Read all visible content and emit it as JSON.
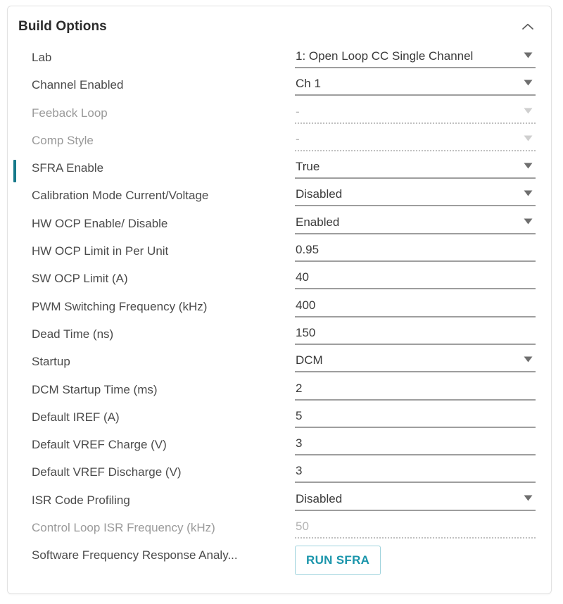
{
  "panel": {
    "title": "Build Options",
    "collapse_icon": "chevron-up-icon",
    "accent_color": "#16798a",
    "border_color": "#e2e2e2",
    "button_accent": "#1a95ab"
  },
  "rows": [
    {
      "label": "Lab",
      "value": "1: Open Loop CC Single Channel",
      "type": "dropdown",
      "disabled": false,
      "selected": false
    },
    {
      "label": "Channel Enabled",
      "value": "Ch 1",
      "type": "dropdown",
      "disabled": false,
      "selected": false
    },
    {
      "label": "Feeback Loop",
      "value": "-",
      "type": "dropdown",
      "disabled": true,
      "selected": false
    },
    {
      "label": "Comp Style",
      "value": "-",
      "type": "dropdown",
      "disabled": true,
      "selected": false
    },
    {
      "label": "SFRA Enable",
      "value": "True",
      "type": "dropdown",
      "disabled": false,
      "selected": true
    },
    {
      "label": "Calibration Mode Current/Voltage",
      "value": "Disabled",
      "type": "dropdown",
      "disabled": false,
      "selected": false
    },
    {
      "label": "HW OCP Enable/ Disable",
      "value": "Enabled",
      "type": "dropdown",
      "disabled": false,
      "selected": false
    },
    {
      "label": "HW OCP Limit in Per Unit",
      "value": "0.95",
      "type": "text",
      "disabled": false,
      "selected": false
    },
    {
      "label": "SW OCP Limit (A)",
      "value": "40",
      "type": "text",
      "disabled": false,
      "selected": false
    },
    {
      "label": "PWM Switching Frequency (kHz)",
      "value": "400",
      "type": "text",
      "disabled": false,
      "selected": false
    },
    {
      "label": "Dead Time (ns)",
      "value": "150",
      "type": "text",
      "disabled": false,
      "selected": false
    },
    {
      "label": "Startup",
      "value": "DCM",
      "type": "dropdown",
      "disabled": false,
      "selected": false
    },
    {
      "label": "DCM Startup Time (ms)",
      "value": "2",
      "type": "text",
      "disabled": false,
      "selected": false
    },
    {
      "label": "Default IREF (A)",
      "value": "5",
      "type": "text",
      "disabled": false,
      "selected": false
    },
    {
      "label": "Default VREF Charge (V)",
      "value": "3",
      "type": "text",
      "disabled": false,
      "selected": false
    },
    {
      "label": "Default VREF Discharge (V)",
      "value": "3",
      "type": "text",
      "disabled": false,
      "selected": false
    },
    {
      "label": "ISR Code Profiling",
      "value": "Disabled",
      "type": "dropdown",
      "disabled": false,
      "selected": false
    },
    {
      "label": "Control Loop ISR Frequency (kHz)",
      "value": "50",
      "type": "text",
      "disabled": true,
      "selected": false
    },
    {
      "label": "Software Frequency Response Analy...",
      "value": "RUN SFRA",
      "type": "button",
      "disabled": false,
      "selected": false
    }
  ]
}
